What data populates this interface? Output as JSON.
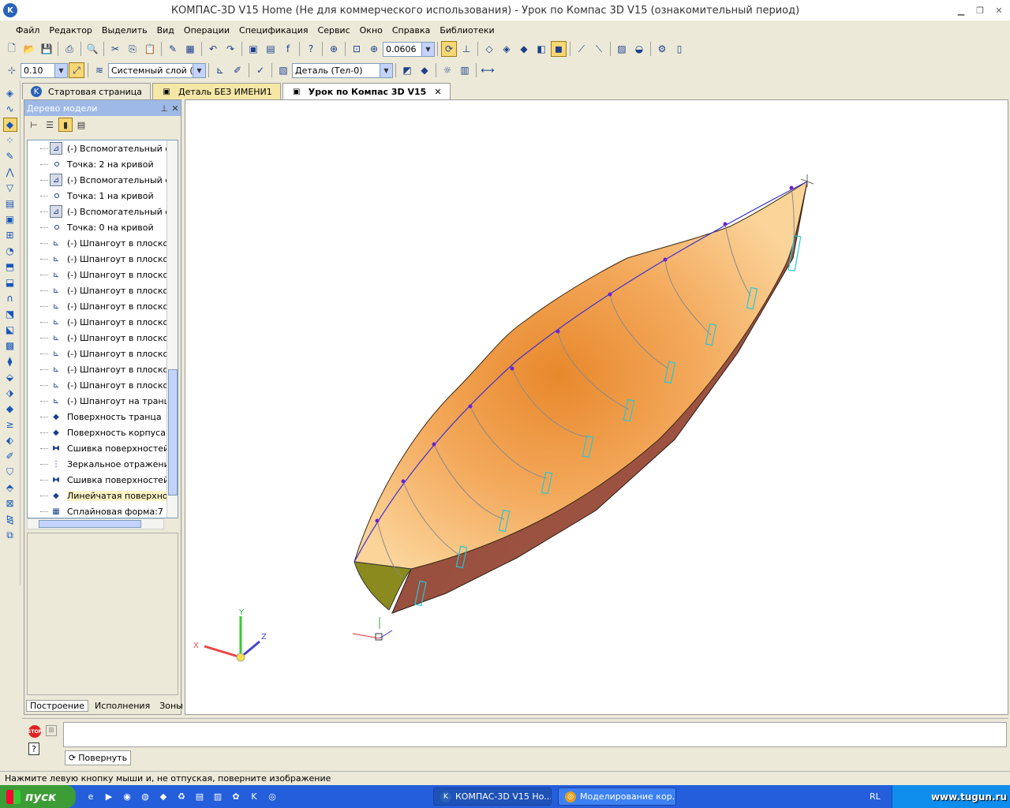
{
  "window": {
    "title": "КОМПАС-3D V15 Home (Не для коммерческого использования) - Урок по Компас 3D V15 (ознакомительный период)",
    "logo_letter": "K"
  },
  "menu": [
    "Файл",
    "Редактор",
    "Выделить",
    "Вид",
    "Операции",
    "Спецификация",
    "Сервис",
    "Окно",
    "Справка",
    "Библиотеки"
  ],
  "toolbar": {
    "zoom_value": "0.0606",
    "step_value": "0.10",
    "layer_value": "Системный слой (0)",
    "body_value": "Деталь (Тел-0)"
  },
  "tabs": [
    {
      "label": "Стартовая страница",
      "icon": "kompas-logo-icon"
    },
    {
      "label": "Деталь БЕЗ ИМЕНИ1",
      "icon": "detail-icon"
    },
    {
      "label": "Урок по Компас 3D V15",
      "icon": "detail-icon",
      "close": "✕"
    }
  ],
  "tree": {
    "header": "Дерево модели",
    "items": [
      {
        "label": "(-) Вспомогательный от",
        "icon": "axis-icon"
      },
      {
        "label": "Точка: 2 на кривой",
        "icon": "point-icon"
      },
      {
        "label": "(-) Вспомогательный от",
        "icon": "axis-icon"
      },
      {
        "label": "Точка: 1 на кривой",
        "icon": "point-icon"
      },
      {
        "label": "(-) Вспомогательный от",
        "icon": "axis-icon"
      },
      {
        "label": "Точка: 0 на кривой",
        "icon": "point-icon"
      },
      {
        "label": "(-) Шпангоут в плоскост",
        "icon": "sketch-icon"
      },
      {
        "label": "(-) Шпангоут в плоскост",
        "icon": "sketch-icon"
      },
      {
        "label": "(-) Шпангоут в плоскост",
        "icon": "sketch-icon"
      },
      {
        "label": "(-) Шпангоут в плоскост",
        "icon": "sketch-icon"
      },
      {
        "label": "(-) Шпангоут в плоскост",
        "icon": "sketch-icon"
      },
      {
        "label": "(-) Шпангоут в плоскост",
        "icon": "sketch-icon"
      },
      {
        "label": "(-) Шпангоут в плоскост",
        "icon": "sketch-icon"
      },
      {
        "label": "(-) Шпангоут в плоскост",
        "icon": "sketch-icon"
      },
      {
        "label": "(-) Шпангоут в плоскост",
        "icon": "sketch-icon"
      },
      {
        "label": "(-) Шпангоут в плоскост",
        "icon": "sketch-icon"
      },
      {
        "label": "(-) Шпангоут на транце",
        "icon": "sketch-icon"
      },
      {
        "label": "Поверхность транца",
        "icon": "surface-icon"
      },
      {
        "label": "Поверхность корпуса, г",
        "icon": "surface-icon"
      },
      {
        "label": "Сшивка поверхностей:2",
        "icon": "stitch-icon"
      },
      {
        "label": "Зеркальное отражение",
        "icon": "mirror-icon"
      },
      {
        "label": "Сшивка поверхностей:3",
        "icon": "stitch-icon"
      },
      {
        "label": "Линейчатая поверхност",
        "icon": "ruled-surface-icon"
      },
      {
        "label": "Сплайновая форма:7",
        "icon": "spline-icon"
      }
    ],
    "bottom_tabs": [
      "Построение",
      "Исполнения",
      "Зоны"
    ]
  },
  "axes": {
    "x": "X",
    "y": "Y",
    "z": "Z"
  },
  "bottom": {
    "stop": "STOP",
    "help": "?",
    "rotate_label": "Повернуть"
  },
  "status": "Нажмите левую кнопку мыши и, не отпуская, поверните изображение",
  "taskbar": {
    "start": "пуск",
    "items": [
      {
        "label": "КОМПАС-3D V15 Ho...",
        "icon": "kompas-icon"
      },
      {
        "label": "Моделирование кор...",
        "icon": "chrome-icon"
      }
    ],
    "lang": "RL",
    "watermark": "www.tugun.ru"
  },
  "colors": {
    "hull_top": "#f3a85a",
    "hull_side": "#9b5043",
    "keel_line": "#3b32d0",
    "frame_line": "#8a8a8a",
    "cyan_frame": "#25c8d8",
    "taskbar": "#245edb"
  }
}
